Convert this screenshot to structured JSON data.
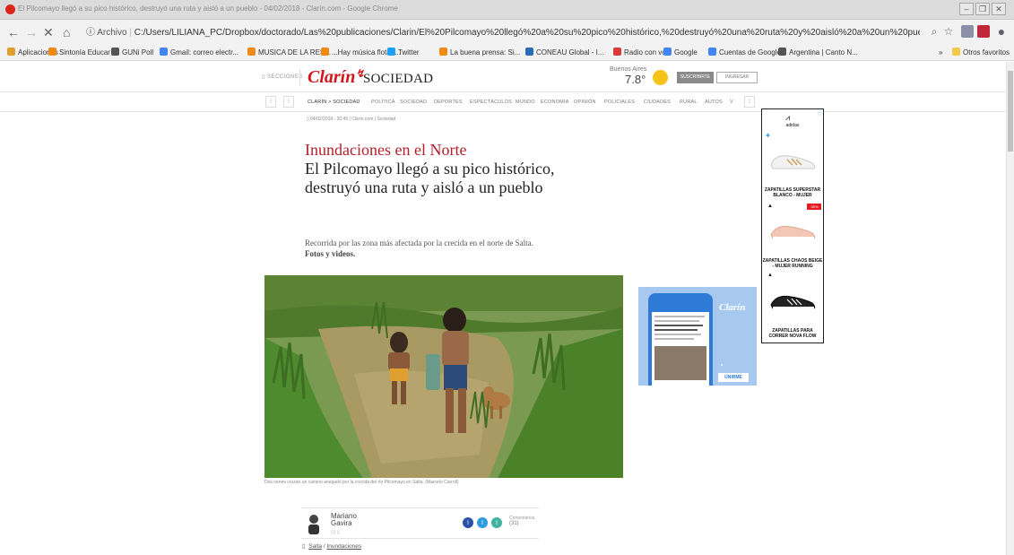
{
  "browser": {
    "tab_title": "El Pilcomayo llegó a su pico histórico, destruyó una ruta y aisló a un pueblo - 04/02/2018 - Clarín.com - Google Chrome",
    "url_scheme": "Archivo",
    "url": "C:/Users/LILIANA_PC/Dropbox/doctorado/Las%20publicaciones/Clarin/El%20Pilcomayo%20llegó%20a%20su%20pico%20histórico,%20destruyó%20una%20ruta%20y%20aisló%20a%20un%20pueblo%20-%2004_02_2018%20-%20Clarín...",
    "bookmarks": [
      {
        "label": "Aplicaciones",
        "color": "#e0a030"
      },
      {
        "label": "Sintonía Educar",
        "color": "#f08a14"
      },
      {
        "label": "GUNi Poll",
        "color": "#555555"
      },
      {
        "label": "Gmail: correo electr...",
        "color": "#4285f4"
      },
      {
        "label": "MUSICA DE LA RES...",
        "color": "#f08a14"
      },
      {
        "label": "...Hay música flotan...",
        "color": "#f08a14"
      },
      {
        "label": "Twitter",
        "color": "#1da1f2"
      },
      {
        "label": "La buena prensa: Si...",
        "color": "#f08a14"
      },
      {
        "label": "CONEAU Global - I...",
        "color": "#2a6bb8"
      },
      {
        "label": "Radio con vos",
        "color": "#d93a3a"
      },
      {
        "label": "Google",
        "color": "#4285f4"
      },
      {
        "label": "Cuentas de Google",
        "color": "#4285f4"
      },
      {
        "label": "Argentina | Canto N...",
        "color": "#555555"
      }
    ],
    "bookmarks_more": "»",
    "other_bookmarks": "Otros favoritos"
  },
  "header": {
    "secciones": "SECCIONES",
    "logo": "Clarín",
    "section": "SOCIEDAD",
    "weather_city": "Buenos Aires",
    "weather_temp": "7.8°",
    "subscribe": "SUSCRIBIRTE",
    "login": "INGRESAR"
  },
  "nav": {
    "items": [
      "CLARÍN > SOCIEDAD",
      "POLÍTICA",
      "SOCIEDAD",
      "DEPORTES",
      "ESPECTÁCULOS",
      "MUNDO",
      "ECONOMÍA",
      "OPINIÓN",
      "POLICIALES",
      "CIUDADES",
      "RURAL",
      "AUTOS",
      "V"
    ]
  },
  "article": {
    "dateline": "04/02/2018 - 20:45  |  Clarín.com  |  Sociedad",
    "kicker": "Inundaciones en el Norte",
    "headline": "El Pilcomayo llegó a su pico histórico, destruyó una ruta y aisló a un pueblo",
    "summary": "Recorrida por las zona más afectada por la crecida en el norte de Salta.",
    "summary_bold": "Fotos y videos.",
    "caption": "Dos nenes cruzan un camino anegado por la crecida del río Pilcomayo en Salta. (Marcelo Carroll)",
    "author_first": "Mariano",
    "author_last": "Gavira",
    "comments_label": "Comentarios",
    "comments_count": "(31)",
    "tag_location": "Salta",
    "tag_topic": "Inundaciones"
  },
  "ads": {
    "telegram_brand": "Clarín",
    "telegram_join": "ÚNIRME",
    "adidas_brand": "adidas",
    "products": [
      "ZAPATILLAS SUPERSTAR BLANCO - MUJER",
      "ZAPATILLAS CHAOS BEIGE - MUJER RUNNING",
      "ZAPATILLAS PARA CORRER NOVA FLOW"
    ],
    "discount": "-30%"
  }
}
